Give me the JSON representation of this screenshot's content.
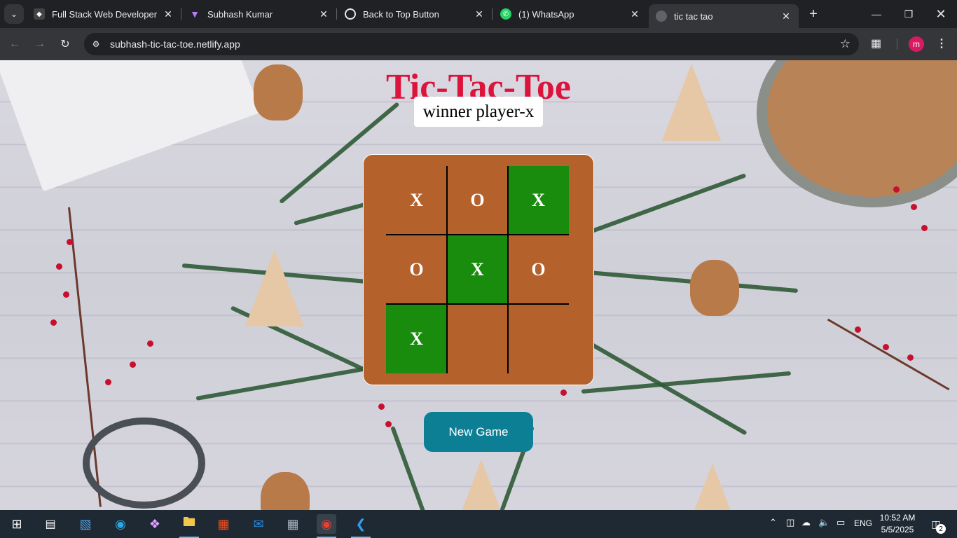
{
  "browser": {
    "tabs": [
      {
        "title": "Full Stack Web Developer",
        "favicon": "mask-icon",
        "active": false
      },
      {
        "title": "Subhash Kumar",
        "favicon": "vite-icon",
        "active": false
      },
      {
        "title": "Back to Top Button",
        "favicon": "openai-icon",
        "active": false
      },
      {
        "title": "(1) WhatsApp",
        "favicon": "whatsapp-icon",
        "active": false
      },
      {
        "title": "tic tac tao",
        "favicon": "globe-icon",
        "active": true
      }
    ],
    "url": "subhash-tic-tac-toe.netlify.app",
    "profile_initial": "m"
  },
  "game": {
    "title": "Tic-Tac-Toe",
    "winner_text": "winner player-x",
    "board": [
      "X",
      "O",
      "X",
      "O",
      "X",
      "O",
      "X",
      "",
      ""
    ],
    "winning_cells": [
      2,
      4,
      6
    ],
    "new_game_label": "New Game"
  },
  "colors": {
    "title": "#dc143c",
    "board": "#b5612b",
    "winning_cell": "#1a8c0d",
    "button": "#0d7f95"
  },
  "taskbar": {
    "language": "ENG",
    "time": "10:52 AM",
    "date": "5/5/2025",
    "notification_count": "2"
  }
}
